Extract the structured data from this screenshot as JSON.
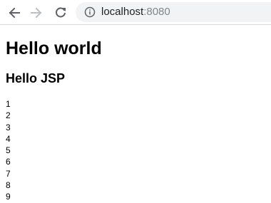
{
  "browser": {
    "url_host": "localhost",
    "url_port": ":8080",
    "icons": [
      "back-arrow-icon",
      "forward-arrow-icon",
      "reload-icon",
      "info-icon"
    ]
  },
  "page": {
    "heading": "Hello world",
    "subheading": "Hello JSP",
    "numbers": [
      "1",
      "2",
      "3",
      "4",
      "5",
      "6",
      "7",
      "8",
      "9"
    ]
  }
}
